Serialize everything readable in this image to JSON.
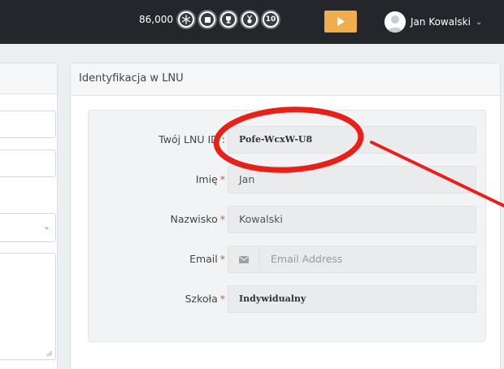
{
  "topbar": {
    "points": "86,000",
    "badges": [
      {
        "icon": "snowflake-badge-icon",
        "text": ""
      },
      {
        "icon": "square-badge-icon",
        "text": ""
      },
      {
        "icon": "trophy-badge-icon",
        "text": ""
      },
      {
        "icon": "medal-badge-icon",
        "text": ""
      },
      {
        "icon": "ten-badge-icon",
        "text": "10"
      }
    ],
    "play_icon": "play-icon",
    "user_name": "Jan Kowalski",
    "user_chevron": "⌄"
  },
  "panel": {
    "title": "Identyfikacja w LNU",
    "fields": {
      "lnu_id": {
        "label": "Twój LNU ID :",
        "value": "Pofe-WcxW-U8"
      },
      "first_name": {
        "label": "Imię",
        "value": "Jan"
      },
      "last_name": {
        "label": "Nazwisko",
        "value": "Kowalski"
      },
      "email": {
        "label": "Email",
        "placeholder": "Email Address",
        "icon": "envelope-icon"
      },
      "school": {
        "label": "Szkoła",
        "value": "Indywidualny"
      }
    },
    "required_mark": "*"
  },
  "left_panel": {
    "select_chevron": "⌄"
  },
  "annotation": {
    "color": "#e8201a"
  },
  "colors": {
    "topbar": "#24262b",
    "play_button": "#f0ad4e",
    "required": "#d9534f"
  }
}
